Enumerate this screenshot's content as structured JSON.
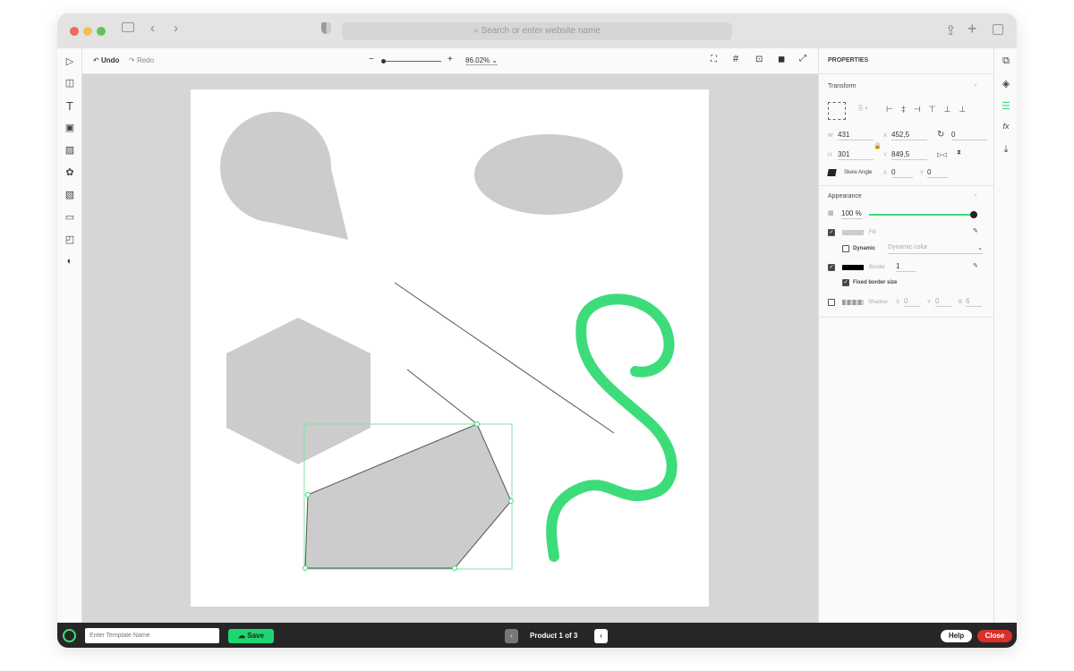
{
  "browser": {
    "url_placeholder": "Search or enter website name"
  },
  "toolbar": {
    "undo": "Undo",
    "redo": "Redo",
    "zoom": "86.02%"
  },
  "panel": {
    "title": "PROPERTIES",
    "transform": {
      "title": "Transform",
      "w_label": "W",
      "w": "431",
      "h_label": "H",
      "h": "301",
      "x_label": "X",
      "x": "452,5",
      "y_label": "Y",
      "y": "849,5",
      "rotation": "0",
      "skew_label": "Skew Angle",
      "skew_x_label": "X",
      "skew_x": "0",
      "skew_y_label": "Y",
      "skew_y": "0"
    },
    "appearance": {
      "title": "Appearance",
      "opacity": "100",
      "opacity_unit": "%",
      "opacity_fraction": 1.0,
      "fill_label": "Fill",
      "fill_color": "#cccccc",
      "dynamic_label": "Dynamic",
      "dynamic_select": "Dynamic color",
      "border_label": "Border",
      "border_color": "#000000",
      "border_width": "1",
      "fixed_border_label": "Fixed border size",
      "shadow_label": "Shadow",
      "shadow_x_label": "X",
      "shadow_x": "0",
      "shadow_y_label": "Y",
      "shadow_y": "0",
      "shadow_b_label": "B",
      "shadow_b": "6"
    }
  },
  "bottom": {
    "template_placeholder": "Enter Template Name",
    "save": "Save",
    "page_label": "Product 1 of 3",
    "help": "Help",
    "close": "Close"
  },
  "colors": {
    "accent": "#3ddc7a",
    "close": "#d9302a",
    "shape": "#cccccc"
  }
}
